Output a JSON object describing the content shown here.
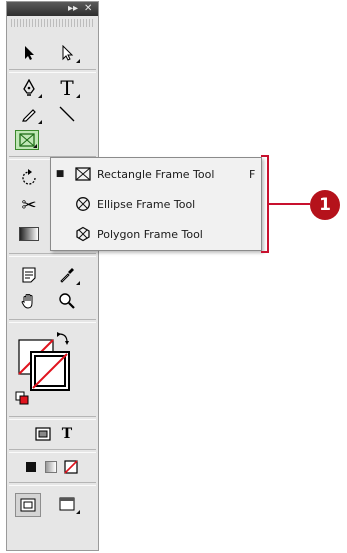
{
  "titlebar": {
    "collapse_icon": "double-arrow-icon",
    "close_icon": "close-icon"
  },
  "tools": [
    {
      "name": "selection-tool-icon"
    },
    {
      "name": "direct-selection-tool-icon"
    },
    {
      "name": "pen-tool-icon"
    },
    {
      "name": "type-tool-icon",
      "glyph": "T"
    },
    {
      "name": "pencil-tool-icon"
    },
    {
      "name": "line-tool-icon"
    },
    {
      "name": "rectangle-frame-tool-icon",
      "selected": true
    },
    {
      "name": "rotate-tool-icon"
    },
    {
      "name": "scissors-tool-icon"
    },
    {
      "name": "gradient-swatch-tool-icon"
    },
    {
      "name": "gradient-feather-tool-icon"
    },
    {
      "name": "note-tool-icon"
    },
    {
      "name": "eyedropper-tool-icon"
    },
    {
      "name": "hand-tool-icon"
    },
    {
      "name": "zoom-tool-icon"
    },
    {
      "name": "fill-stroke-swatch-icon"
    },
    {
      "name": "formatting-container-icon"
    },
    {
      "name": "formatting-text-icon",
      "glyph": "T"
    },
    {
      "name": "apply-color-icon"
    },
    {
      "name": "apply-gradient-icon"
    },
    {
      "name": "apply-none-icon"
    },
    {
      "name": "normal-view-icon"
    },
    {
      "name": "preview-mode-icon"
    }
  ],
  "flyout": {
    "items": [
      {
        "label": "Rectangle Frame Tool",
        "shortcut": "F",
        "checked": true,
        "icon": "rectangle-frame-icon"
      },
      {
        "label": "Ellipse Frame Tool",
        "shortcut": "",
        "checked": false,
        "icon": "ellipse-frame-icon"
      },
      {
        "label": "Polygon Frame Tool",
        "shortcut": "",
        "checked": false,
        "icon": "polygon-frame-icon"
      }
    ],
    "check_glyph": "■"
  },
  "callout": {
    "number": "1"
  },
  "colors": {
    "panel_bg": "#e6e6e6",
    "titlebar": "#3a3a3a",
    "callout_red": "#c8102e",
    "selected_tool_bg": "#bfe7b5",
    "selected_tool_border": "#3c8a2e"
  }
}
